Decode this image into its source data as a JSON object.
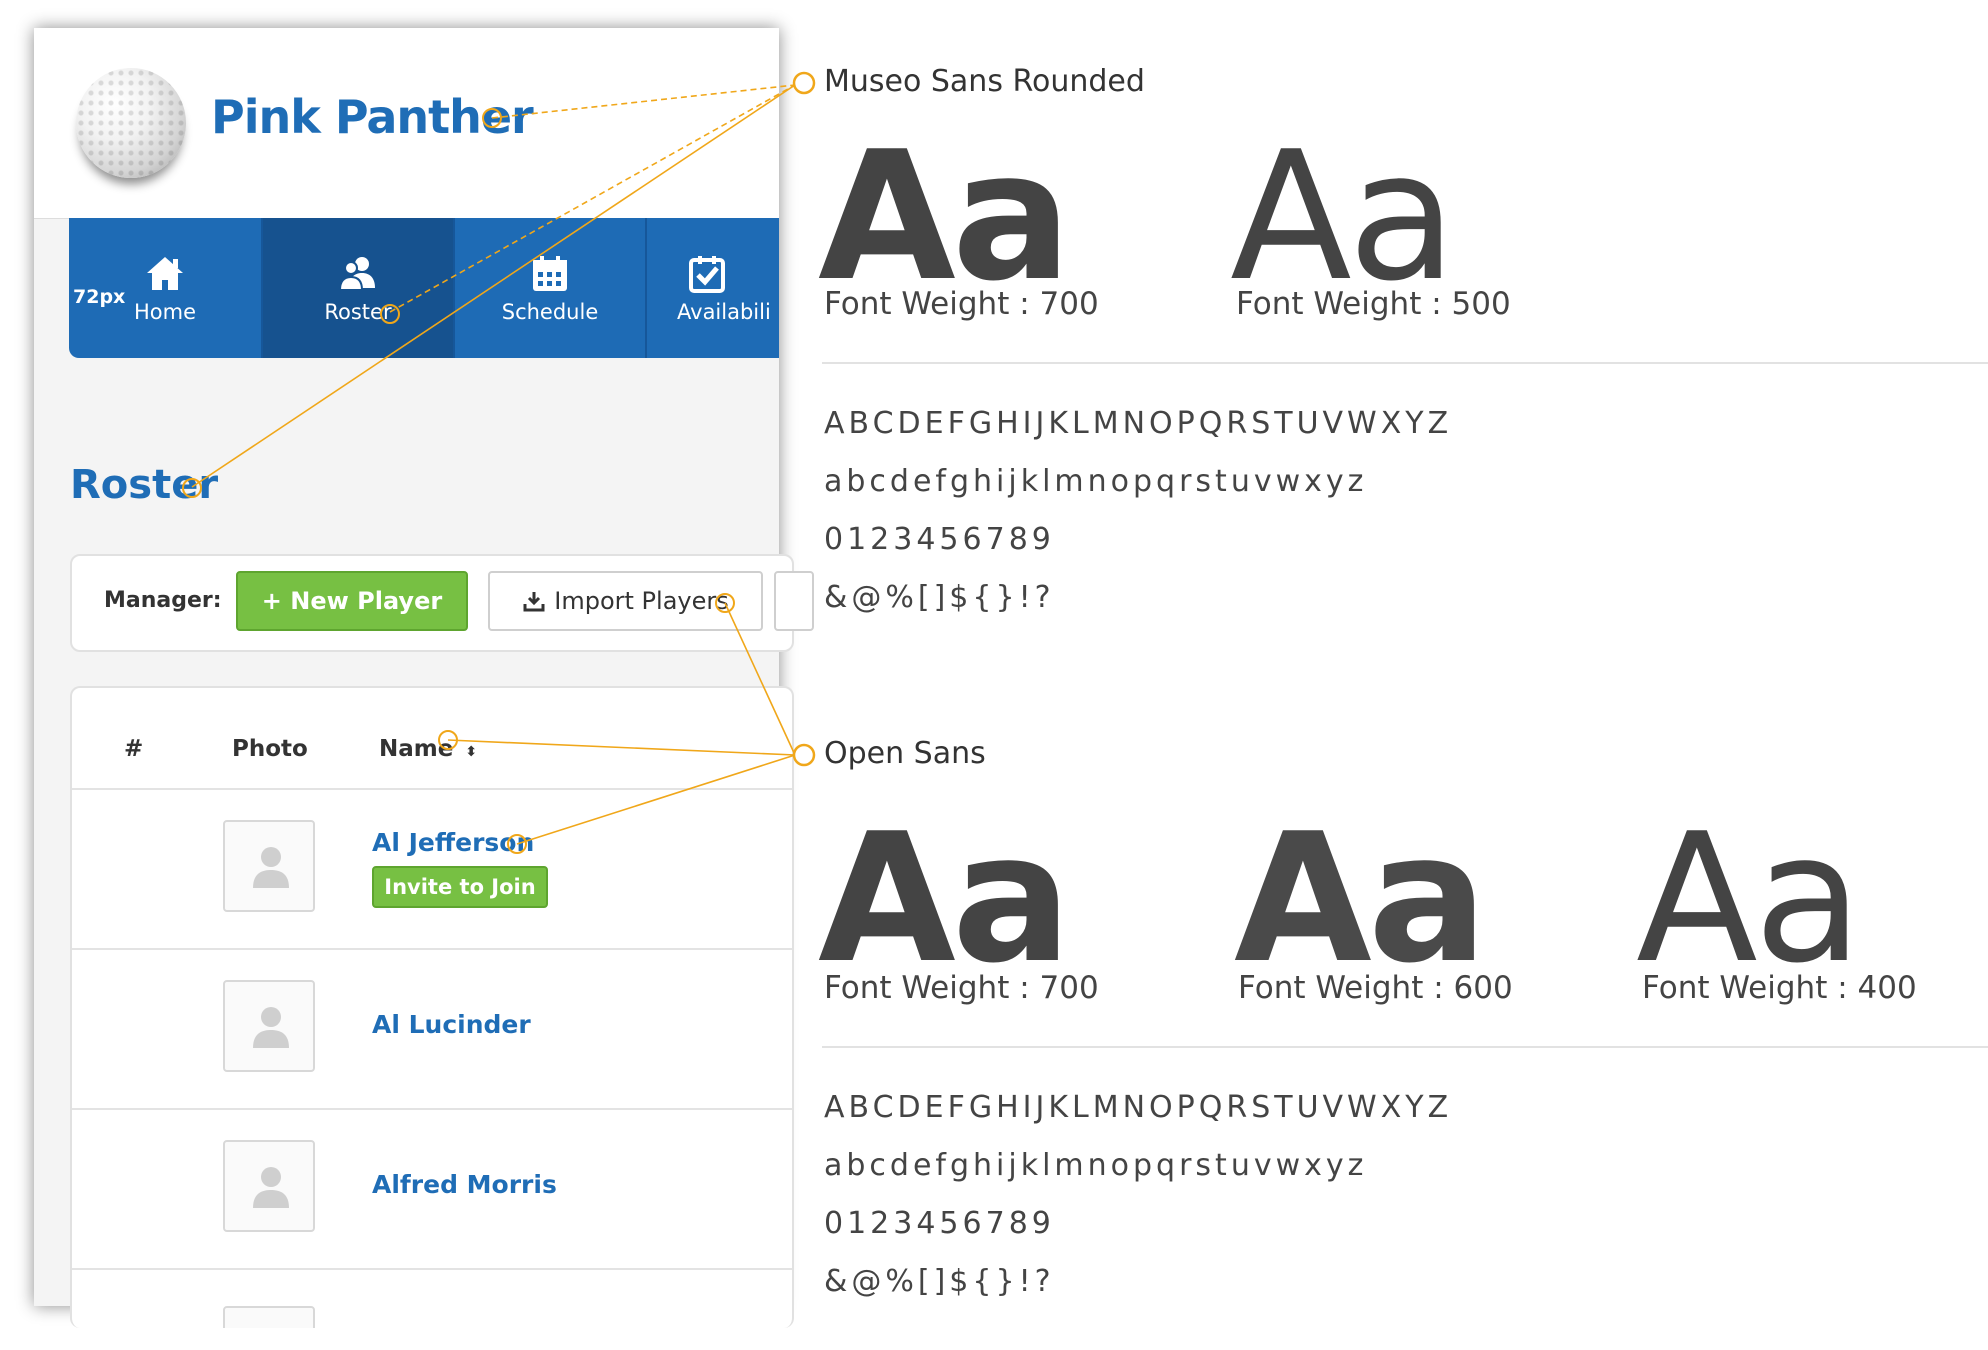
{
  "app": {
    "team_name": "Pink Panther",
    "nav": {
      "size_note": "72px",
      "items": [
        {
          "label": "Home",
          "icon": "home-icon"
        },
        {
          "label": "Roster",
          "icon": "users-icon"
        },
        {
          "label": "Schedule",
          "icon": "calendar-icon"
        },
        {
          "label": "Availabili",
          "icon": "check-calendar-icon"
        }
      ]
    },
    "page_title": "Roster",
    "toolbar": {
      "manager_label": "Manager:",
      "new_player": "+ New Player",
      "import_players": "Import Players"
    },
    "table": {
      "columns": [
        "#",
        "Photo",
        "Name"
      ],
      "rows": [
        {
          "name": "Al Jefferson",
          "action": "Invite to Join"
        },
        {
          "name": "Al Lucinder"
        },
        {
          "name": "Alfred Morris"
        }
      ]
    }
  },
  "specimens": {
    "museo": {
      "name": "Museo Sans Rounded",
      "sample": "Aa",
      "weights": [
        "Font Weight : 700",
        "Font Weight : 500"
      ],
      "uppercase": "ABCDEFGHIJKLMNOPQRSTUVWXYZ",
      "lowercase": "abcdefghijklmnopqrstuvwxyz",
      "digits": "0123456789",
      "symbols": "&@%[]${}!?"
    },
    "open_sans": {
      "name": "Open Sans",
      "sample": "Aa",
      "weights": [
        "Font Weight : 700",
        "Font Weight : 600",
        "Font Weight : 400"
      ],
      "uppercase": "ABCDEFGHIJKLMNOPQRSTUVWXYZ",
      "lowercase": "abcdefghijklmnopqrstuvwxyz",
      "digits": "0123456789",
      "symbols": "&@%[]${}!?"
    }
  },
  "colors": {
    "brand_blue": "#1f6db6",
    "nav_blue": "#1e6bb5",
    "green": "#77c043",
    "annotation": "#f0a71a"
  }
}
